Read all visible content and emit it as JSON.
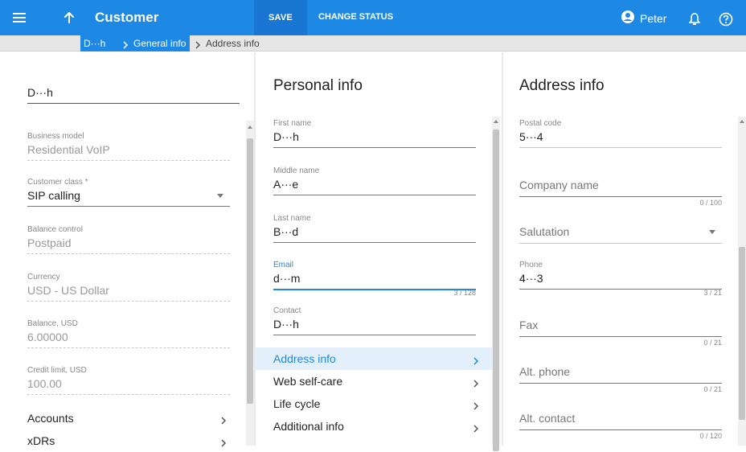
{
  "topbar": {
    "title": "Customer",
    "save_label": "SAVE",
    "change_status_label": "CHANGE STATUS",
    "user_name": "Peter",
    "menu_icon": "hamburger-menu-icon",
    "back_icon": "arrow-up-icon",
    "user_icon": "account-circle-icon",
    "bell_icon": "bell-icon",
    "help_icon": "help-circle-icon"
  },
  "breadcrumb": {
    "items": [
      "D···h",
      "General info",
      "Address info"
    ]
  },
  "left": {
    "name": "D···h",
    "fields": [
      {
        "label": "Business model",
        "value": "Residential VoIP"
      },
      {
        "label": "Customer class *",
        "value": "SIP calling"
      },
      {
        "label": "Balance control",
        "value": "Postpaid"
      },
      {
        "label": "Currency",
        "value": "USD - US Dollar"
      },
      {
        "label": "Balance, USD",
        "value": "6.00000"
      },
      {
        "label": "Credit limit, USD",
        "value": "100.00"
      }
    ],
    "nav": [
      {
        "label": "Accounts"
      },
      {
        "label": "xDRs"
      }
    ]
  },
  "personal": {
    "title": "Personal info",
    "fields": [
      {
        "label": "First name",
        "value": "D···h"
      },
      {
        "label": "Middle name",
        "value": "A···e"
      },
      {
        "label": "Last name",
        "value": "B···d"
      },
      {
        "label": "Email",
        "value": "d···m",
        "counter": "3 / 128"
      },
      {
        "label": "Contact",
        "value": "D···h"
      }
    ],
    "nav": [
      {
        "label": "Address info"
      },
      {
        "label": "Web self-care"
      },
      {
        "label": "Life cycle"
      },
      {
        "label": "Additional info"
      }
    ]
  },
  "address": {
    "title": "Address info",
    "postal": {
      "label": "Postal code",
      "value": "5···4"
    },
    "company": {
      "placeholder": "Company name",
      "counter": "0 / 100"
    },
    "salutation": {
      "placeholder": "Salutation"
    },
    "phone": {
      "label": "Phone",
      "value": "4···3",
      "counter": "3 / 21"
    },
    "fax": {
      "placeholder": "Fax",
      "counter": "0 / 21"
    },
    "alt_phone": {
      "placeholder": "Alt. phone",
      "counter": "0 / 21"
    },
    "alt_contact": {
      "placeholder": "Alt. contact",
      "counter": "0 / 120"
    }
  },
  "colors": {
    "accent": "#1e88e5",
    "save_bg": "#1976d2",
    "active_nav_bg": "#e3f0fb"
  }
}
